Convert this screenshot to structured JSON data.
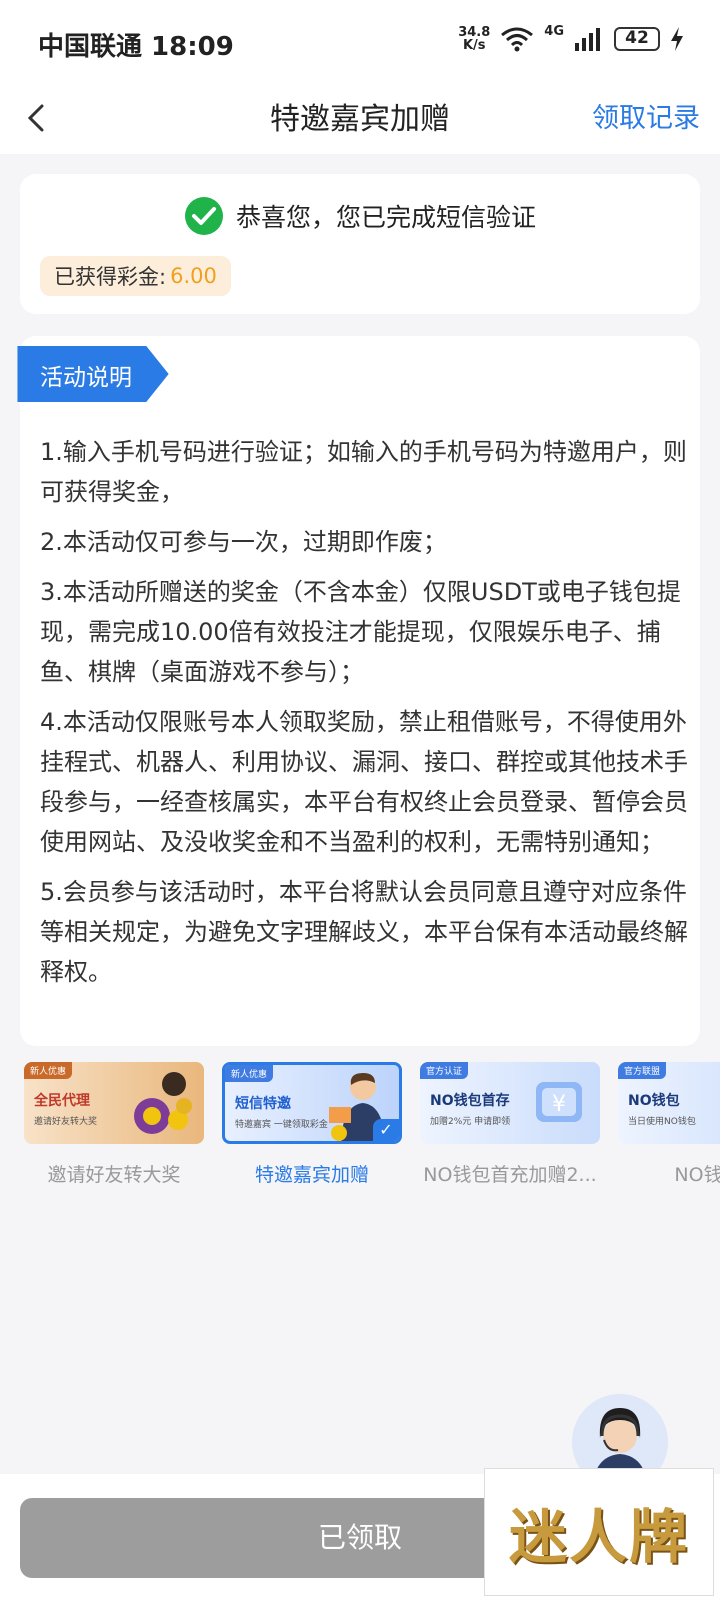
{
  "status_bar": {
    "carrier_time": "中国联通 18:09",
    "speed_value": "34.8",
    "speed_unit": "K/s",
    "network": "4G",
    "battery": "42"
  },
  "nav": {
    "title": "特邀嘉宾加赠",
    "right_link": "领取记录"
  },
  "success": {
    "message": "恭喜您，您已完成短信验证",
    "bonus_label": "已获得彩金:",
    "bonus_value": "6.00"
  },
  "rules": {
    "tag": "活动说明",
    "items": [
      "1.输入手机号码进行验证；如输入的手机号码为特邀用户，则可获得奖金，",
      "2.本活动仅可参与一次，过期即作废；",
      "3.本活动所赠送的奖金（不含本金）仅限USDT或电子钱包提现，需完成10.00倍有效投注才能提现，仅限娱乐电子、捕鱼、棋牌（桌面游戏不参与）；",
      "4.本活动仅限账号本人领取奖励，禁止租借账号，不得使用外挂程式、机器人、利用协议、漏洞、接口、群控或其他技术手段参与，一经查核属实，本平台有权终止会员登录、暂停会员使用网站、及没收奖金和不当盈利的权利，无需特别通知；",
      "5.会员参与该活动时，本平台将默认会员同意且遵守对应条件等相关规定，为避免文字理解歧义，本平台保有本活动最终解释权。"
    ]
  },
  "carousel": [
    {
      "label": "邀请好友转大奖",
      "tag": "新人优惠",
      "thumb_title": "全民代理",
      "thumb_sub": "邀请好友转大奖"
    },
    {
      "label": "特邀嘉宾加赠",
      "tag": "新人优惠",
      "thumb_title": "短信特邀",
      "thumb_sub": "特邀嘉宾 一键领取彩金"
    },
    {
      "label": "NO钱包首充加赠2...",
      "tag": "官方认证",
      "thumb_title": "NO钱包首存",
      "thumb_sub": "加赠2%元 申请即领"
    },
    {
      "label": "NO钱包",
      "tag": "官方联盟",
      "thumb_title": "NO钱包",
      "thumb_sub": "当日使用NO钱包"
    }
  ],
  "footer": {
    "claim_button": "已领取",
    "watermark": "迷人牌"
  },
  "colors": {
    "accent": "#2b7be6",
    "success": "#1fb34a",
    "bonus": "#f0a020",
    "disabled_button": "#9d9d9d"
  }
}
